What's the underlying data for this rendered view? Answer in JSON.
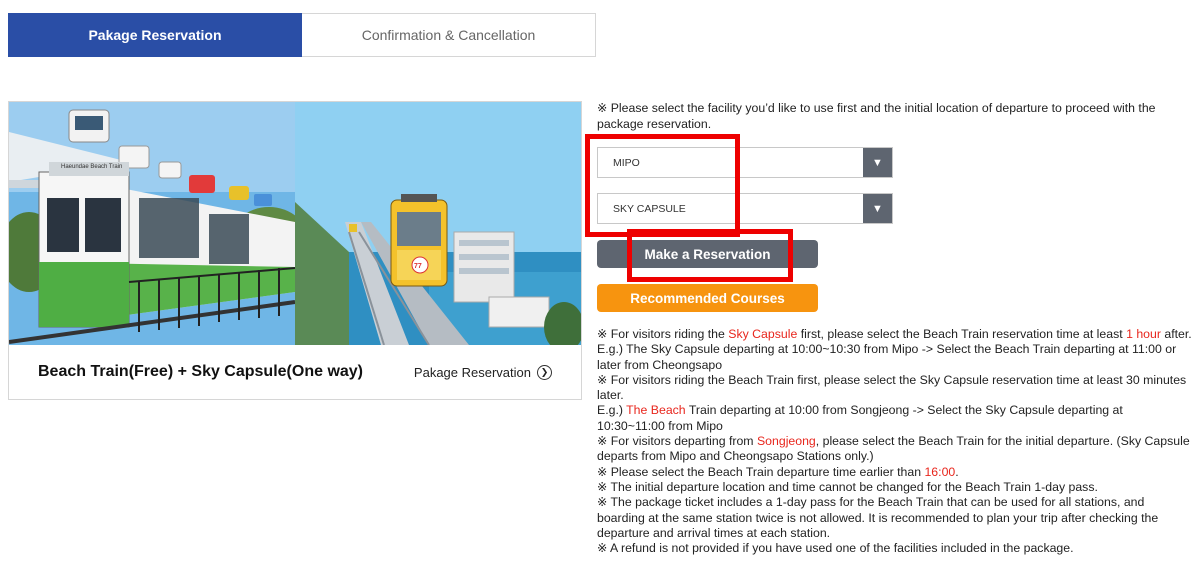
{
  "tabs": [
    {
      "label": "Pakage Reservation",
      "active": true
    },
    {
      "label": "Confirmation & Cancellation",
      "active": false
    }
  ],
  "package": {
    "title": "Beach Train(Free) + Sky Capsule(One way)",
    "link_label": "Pakage Reservation",
    "link_icon": "chevron-right-circle-icon",
    "photo_sign": "Haeundae Beach Train",
    "capsule_number": "77"
  },
  "intro": "※ Please select the facility you’d like to use first and the initial location of departure to proceed with the package reservation.",
  "selects": {
    "departure": {
      "value": "MIPO",
      "arrow_icon": "triangle-down-icon"
    },
    "facility": {
      "value": "SKY CAPSULE",
      "arrow_icon": "triangle-down-icon"
    }
  },
  "buttons": {
    "reserve": "Make a Reservation",
    "courses": "Recommended Courses"
  },
  "notes": {
    "n1": {
      "pre": "※ For visitors riding the ",
      "hl1": "Sky Capsule",
      "mid": " first, please select the Beach Train reservation time at least ",
      "hl2": "1 hour",
      "post": " after."
    },
    "n2": "E.g.) The Sky Capsule departing at 10:00~10:30 from Mipo -> Select the Beach Train departing at 11:00 or later from Cheongsapo",
    "n3": "※ For visitors riding the Beach Train first, please select the Sky Capsule reservation time at least 30 minutes later.",
    "n4": {
      "pre": "E.g.) ",
      "hl": "The Beach",
      "post": " Train departing at 10:00 from Songjeong -> Select the Sky Capsule departing at 10:30~11:00 from Mipo"
    },
    "n5": {
      "pre": "※ For visitors departing from ",
      "hl": "Songjeong",
      "post": ", please select the Beach Train for the initial departure. (Sky Capsule departs from Mipo and Cheongsapo Stations only.)"
    },
    "n6": {
      "pre": "※ Please select the Beach Train departure time earlier than ",
      "hl": "16:00",
      "post": "."
    },
    "n7": "※ The initial departure location and time cannot be changed for the Beach Train 1-day pass.",
    "n8": "※ The package ticket includes a 1-day pass for the Beach Train that can be used for all stations, and boarding at the same station twice is not allowed. It is recommended to plan your trip after checking the departure and arrival times at each station.",
    "n9": "※ A refund is not provided if you have used one of the facilities included in the package."
  },
  "colors": {
    "tab_active": "#2a4ea6",
    "button_dark": "#5e6570",
    "button_orange": "#f7940f",
    "highlight_red": "#e8261d",
    "annotation_red": "#ee0000"
  }
}
